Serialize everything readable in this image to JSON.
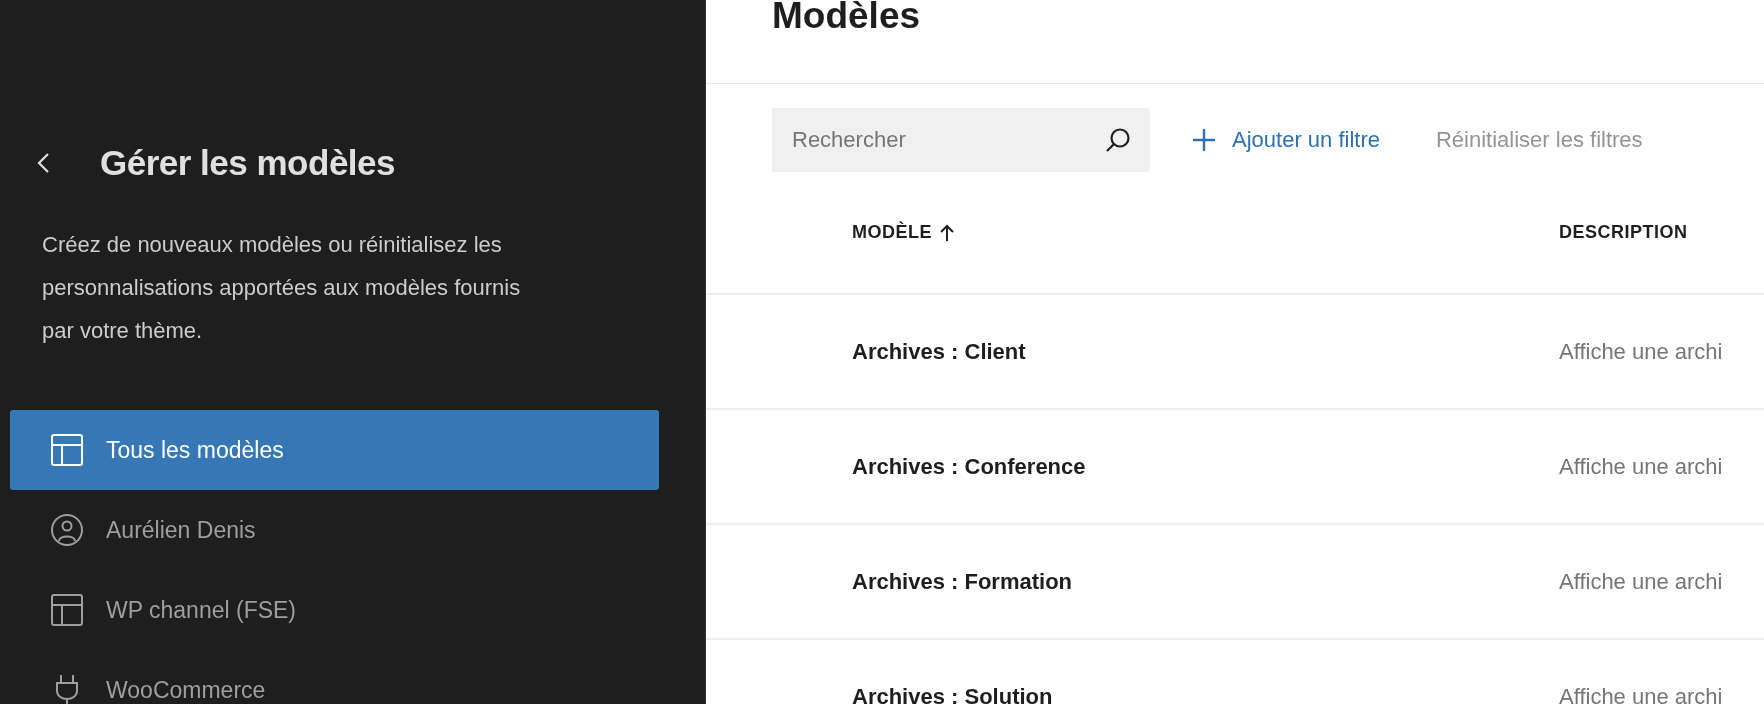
{
  "sidebar": {
    "title": "Gérer les modèles",
    "description": "Créez de nouveaux modèles ou réinitialisez les personnalisations apportées aux modèles fournis par votre thème.",
    "items": [
      {
        "label": "Tous les modèles",
        "kind": "layout",
        "selected": true
      },
      {
        "label": "Aurélien Denis",
        "kind": "user",
        "selected": false
      },
      {
        "label": "WP channel (FSE)",
        "kind": "layout",
        "selected": false
      },
      {
        "label": "WooCommerce",
        "kind": "plugin",
        "selected": false
      }
    ]
  },
  "main": {
    "title": "Modèles",
    "search": {
      "placeholder": "Rechercher"
    },
    "add_filter": "Ajouter un filtre",
    "reset_filters": "Réinitialiser les filtres",
    "table": {
      "columns": [
        {
          "label": "MODÈLE",
          "sorted": true
        },
        {
          "label": "DESCRIPTION",
          "sorted": false
        }
      ],
      "rows": [
        {
          "title": "Archives : Client",
          "description": "Affiche une archi"
        },
        {
          "title": "Archives : Conference",
          "description": "Affiche une archi"
        },
        {
          "title": "Archives : Formation",
          "description": "Affiche une archi"
        },
        {
          "title": "Archives : Solution",
          "description": "Affiche une archi"
        }
      ]
    }
  }
}
